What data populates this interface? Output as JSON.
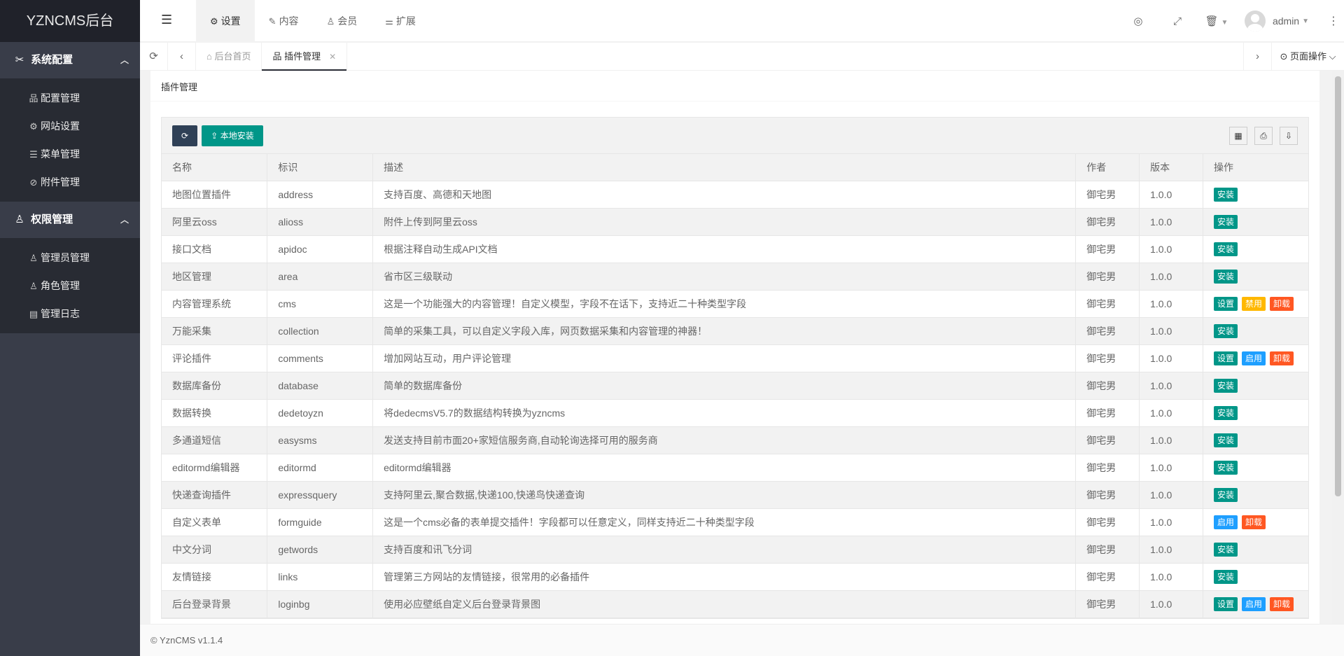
{
  "sidebar": {
    "logo": "YZNCMS后台",
    "groups": [
      {
        "title": "系统配置",
        "items": [
          {
            "label": "配置管理"
          },
          {
            "label": "网站设置"
          },
          {
            "label": "菜单管理"
          },
          {
            "label": "附件管理"
          }
        ]
      },
      {
        "title": "权限管理",
        "items": [
          {
            "label": "管理员管理"
          },
          {
            "label": "角色管理"
          },
          {
            "label": "管理日志"
          }
        ]
      }
    ]
  },
  "header": {
    "menu": [
      {
        "label": "设置"
      },
      {
        "label": "内容"
      },
      {
        "label": "会员"
      },
      {
        "label": "扩展"
      }
    ],
    "username": "admin"
  },
  "tabs": {
    "items": [
      {
        "label": "后台首页"
      },
      {
        "label": "插件管理"
      }
    ],
    "page_ops": "页面操作"
  },
  "main": {
    "title": "插件管理",
    "toolbar": {
      "install_label": "本地安装"
    },
    "columns": [
      "名称",
      "标识",
      "描述",
      "作者",
      "版本",
      "操作"
    ],
    "rows": [
      {
        "name": "地图位置插件",
        "id": "address",
        "desc": "支持百度、高德和天地图",
        "author": "御宅男",
        "version": "1.0.0",
        "actions": [
          {
            "label": "安装",
            "color": "green"
          }
        ]
      },
      {
        "name": "阿里云oss",
        "id": "alioss",
        "desc": "附件上传到阿里云oss",
        "author": "御宅男",
        "version": "1.0.0",
        "actions": [
          {
            "label": "安装",
            "color": "green"
          }
        ]
      },
      {
        "name": "接口文档",
        "id": "apidoc",
        "desc": "根据注释自动生成API文档",
        "author": "御宅男",
        "version": "1.0.0",
        "actions": [
          {
            "label": "安装",
            "color": "green"
          }
        ]
      },
      {
        "name": "地区管理",
        "id": "area",
        "desc": "省市区三级联动",
        "author": "御宅男",
        "version": "1.0.0",
        "actions": [
          {
            "label": "安装",
            "color": "green"
          }
        ]
      },
      {
        "name": "内容管理系统",
        "id": "cms",
        "desc": "这是一个功能强大的内容管理！自定义模型，字段不在话下，支持近二十种类型字段",
        "author": "御宅男",
        "version": "1.0.0",
        "actions": [
          {
            "label": "设置",
            "color": "green"
          },
          {
            "label": "禁用",
            "color": "orange"
          },
          {
            "label": "卸载",
            "color": "red"
          }
        ]
      },
      {
        "name": "万能采集",
        "id": "collection",
        "desc": "简单的采集工具，可以自定义字段入库，网页数据采集和内容管理的神器！",
        "author": "御宅男",
        "version": "1.0.0",
        "actions": [
          {
            "label": "安装",
            "color": "green"
          }
        ]
      },
      {
        "name": "评论插件",
        "id": "comments",
        "desc": "增加网站互动，用户评论管理",
        "author": "御宅男",
        "version": "1.0.0",
        "actions": [
          {
            "label": "设置",
            "color": "green"
          },
          {
            "label": "启用",
            "color": "blue"
          },
          {
            "label": "卸载",
            "color": "red"
          }
        ]
      },
      {
        "name": "数据库备份",
        "id": "database",
        "desc": "简单的数据库备份",
        "author": "御宅男",
        "version": "1.0.0",
        "actions": [
          {
            "label": "安装",
            "color": "green"
          }
        ]
      },
      {
        "name": "数据转换",
        "id": "dedetoyzn",
        "desc": "将dedecmsV5.7的数据结构转换为yzncms",
        "author": "御宅男",
        "version": "1.0.0",
        "actions": [
          {
            "label": "安装",
            "color": "green"
          }
        ]
      },
      {
        "name": "多通道短信",
        "id": "easysms",
        "desc": "发送支持目前市面20+家短信服务商,自动轮询选择可用的服务商",
        "author": "御宅男",
        "version": "1.0.0",
        "actions": [
          {
            "label": "安装",
            "color": "green"
          }
        ]
      },
      {
        "name": "editormd编辑器",
        "id": "editormd",
        "desc": "editormd编辑器",
        "author": "御宅男",
        "version": "1.0.0",
        "actions": [
          {
            "label": "安装",
            "color": "green"
          }
        ]
      },
      {
        "name": "快递查询插件",
        "id": "expressquery",
        "desc": "支持阿里云,聚合数据,快递100,快递鸟快递查询",
        "author": "御宅男",
        "version": "1.0.0",
        "actions": [
          {
            "label": "安装",
            "color": "green"
          }
        ]
      },
      {
        "name": "自定义表单",
        "id": "formguide",
        "desc": "这是一个cms必备的表单提交插件！字段都可以任意定义，同样支持近二十种类型字段",
        "author": "御宅男",
        "version": "1.0.0",
        "actions": [
          {
            "label": "启用",
            "color": "blue"
          },
          {
            "label": "卸载",
            "color": "red"
          }
        ]
      },
      {
        "name": "中文分词",
        "id": "getwords",
        "desc": "支持百度和讯飞分词",
        "author": "御宅男",
        "version": "1.0.0",
        "actions": [
          {
            "label": "安装",
            "color": "green"
          }
        ]
      },
      {
        "name": "友情链接",
        "id": "links",
        "desc": "管理第三方网站的友情链接，很常用的必备插件",
        "author": "御宅男",
        "version": "1.0.0",
        "actions": [
          {
            "label": "安装",
            "color": "green"
          }
        ]
      },
      {
        "name": "后台登录背景",
        "id": "loginbg",
        "desc": "使用必应壁纸自定义后台登录背景图",
        "author": "御宅男",
        "version": "1.0.0",
        "actions": [
          {
            "label": "设置",
            "color": "green"
          },
          {
            "label": "启用",
            "color": "blue"
          },
          {
            "label": "卸载",
            "color": "red"
          }
        ]
      }
    ]
  },
  "footer": {
    "text": "© YznCMS v1.1.4"
  }
}
